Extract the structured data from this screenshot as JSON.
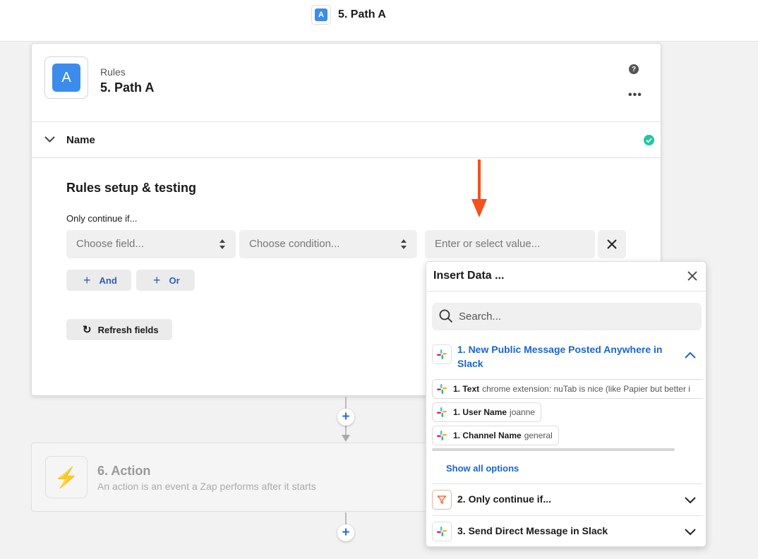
{
  "topbar": {
    "icon_letter": "A",
    "title": "5. Path A"
  },
  "card": {
    "logo_letter": "A",
    "app_name": "Rules",
    "step_title": "5. Path A",
    "help_icon": "?",
    "more_icon": "•••",
    "name_section": "Name",
    "section_title": "Rules setup & testing",
    "only_continue_label": "Only continue if...",
    "field_placeholder": "Choose field...",
    "condition_placeholder": "Choose condition...",
    "value_placeholder": "Enter or select value...",
    "and_label": "And",
    "or_label": "Or",
    "refresh_label": "Refresh fields"
  },
  "action": {
    "title": "6. Action",
    "description": "An action is an event a Zap performs after it starts"
  },
  "insert_data": {
    "title": "Insert Data ...",
    "search_placeholder": "Search...",
    "app_title": "1. New Public Message Posted Anywhere in Slack",
    "rows": [
      {
        "label": "1. Text",
        "value": "chrome extension: nuTab is nice (like Papier but better i"
      },
      {
        "label": "1. User Name",
        "value": "joanne"
      },
      {
        "label": "1. Channel Name",
        "value": "general"
      }
    ],
    "show_all": "Show all options",
    "steps": [
      {
        "title": "2. Only continue if..."
      },
      {
        "title": "3. Send Direct Message in Slack"
      }
    ]
  },
  "colors": {
    "accent": "#3b8ced",
    "link": "#1a64d6",
    "success": "#1fc8a0",
    "pointer_arrow": "#f5501e"
  }
}
